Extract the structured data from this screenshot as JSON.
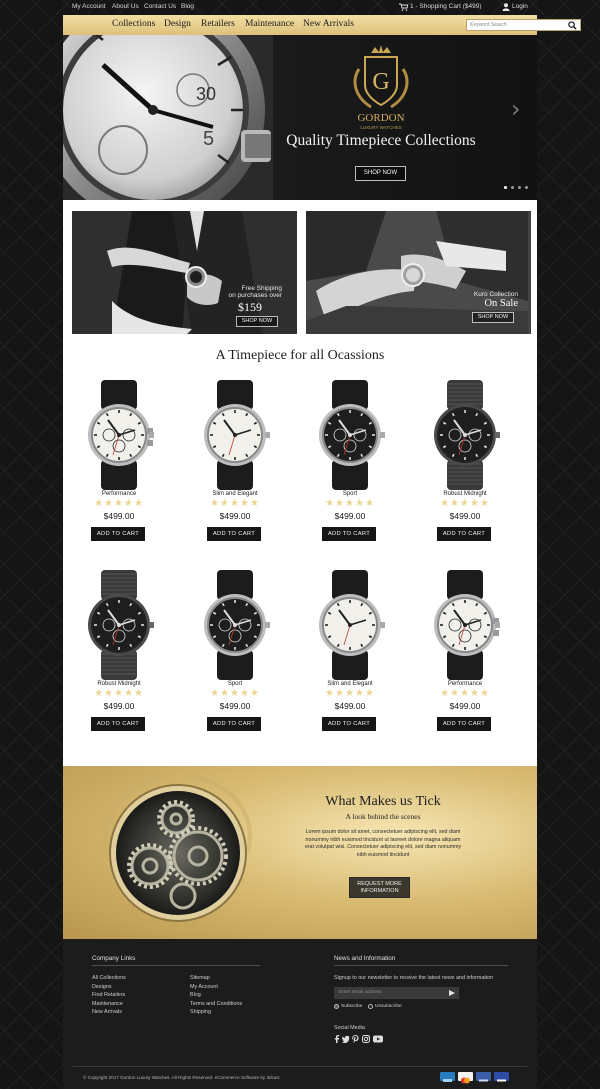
{
  "topbar": {
    "links": [
      "My Account",
      "About Us",
      "Contact Us",
      "Blog"
    ],
    "cart": "1 - Shopping Cart ($499)",
    "login": "Login"
  },
  "nav": {
    "items": [
      "Collections",
      "Design",
      "Retailers",
      "Maintenance",
      "New Arrivals"
    ],
    "search_placeholder": "Keyword Search"
  },
  "hero": {
    "logo_letter": "G",
    "logo_name": "GORDON",
    "logo_sub": "LUXURY WATCHES",
    "title": "Quality Timepiece Collections",
    "button": "SHOP NOW",
    "slide_count": 4,
    "active_slide": 1
  },
  "promos": [
    {
      "line1": "Free Shipping",
      "line2": "on purchases over",
      "big": "$159",
      "button": "SHOP NOW"
    },
    {
      "line1": "Kuro Collection",
      "line2": "",
      "big": "On Sale",
      "button": "SHOP NOW"
    }
  ],
  "products_title": "A Timepiece for all Ocassions",
  "products": [
    {
      "name": "Performance",
      "price": "$499.00",
      "button": "ADD TO CART",
      "style": "white-chrono",
      "stars": "★★★★★"
    },
    {
      "name": "Slim and Elegant",
      "price": "$499.00",
      "button": "ADD TO CART",
      "style": "white-leather",
      "stars": "★★★★★"
    },
    {
      "name": "Sport",
      "price": "$499.00",
      "button": "ADD TO CART",
      "style": "black-leather",
      "stars": "★★★★★"
    },
    {
      "name": "Robust Midnight",
      "price": "$499.00",
      "button": "ADD TO CART",
      "style": "black-metal",
      "stars": "★★★★★"
    },
    {
      "name": "Robust Midnight",
      "price": "$499.00",
      "button": "ADD TO CART",
      "style": "black-metal",
      "stars": "★★★★★"
    },
    {
      "name": "Sport",
      "price": "$499.00",
      "button": "ADD TO CART",
      "style": "black-leather",
      "stars": "★★★★★"
    },
    {
      "name": "Slim and Elegant",
      "price": "$499.00",
      "button": "ADD TO CART",
      "style": "white-leather",
      "stars": "★★★★★"
    },
    {
      "name": "Performance",
      "price": "$499.00",
      "button": "ADD TO CART",
      "style": "white-chrono",
      "stars": "★★★★★"
    }
  ],
  "tick": {
    "title": "What Makes us Tick",
    "subtitle": "A look behind the scenes",
    "body": "Lorem ipsum dolor sit amet, consectetuer adipiscing elit, sed diam nonummy nibh euismod tincidunt ut laoreet dolore magna aliquam erat volutpat wisi. Consectetuer adipiscing elit, sed diam nonummy nibh euismod tincidunt",
    "button_line1": "REQUEST MORE",
    "button_line2": "INFORMATION"
  },
  "footer": {
    "company_heading": "Company Links",
    "links_col1": [
      "All Collections",
      "Designs",
      "Find Retailers",
      "Maintenance",
      "New Arrivals"
    ],
    "links_col2": [
      "Sitemap",
      "My Account",
      "Blog",
      "Terms and Conditions",
      "Shipping"
    ],
    "news_heading": "News and Information",
    "news_text": "Signup to our newsletter to receive the latest news and information",
    "email_placeholder": "Enter email address",
    "subscribe": "Subscribe",
    "unsubscribe": "Unsubscribe",
    "social_heading": "Social Media",
    "social_icons": [
      "facebook-icon",
      "twitter-icon",
      "pinterest-icon",
      "instagram-icon",
      "youtube-icon"
    ],
    "copyright": "© Copyright 2017 Gordon Luxury Watches. All Rights Reserved. eCommerce Software by 3dcart.",
    "cards": [
      "American Express",
      "MasterCard",
      "Discover",
      "Visa"
    ]
  },
  "colors": {
    "gold": "#dcc07b",
    "dark": "#161616",
    "star": "#ecd593"
  }
}
